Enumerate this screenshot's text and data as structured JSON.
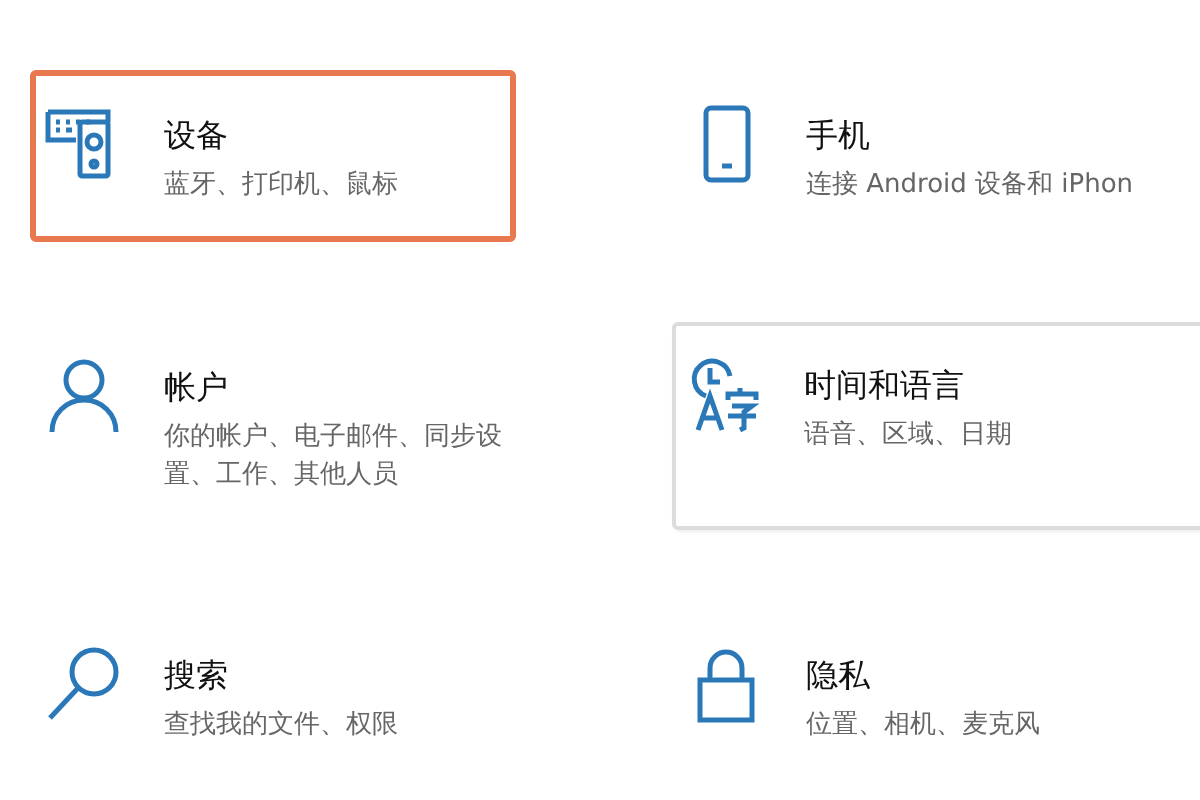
{
  "tiles": [
    {
      "kind": "devices",
      "title": "设备",
      "subtitle": "蓝牙、打印机、鼠标",
      "highlighted": true,
      "hovered": false
    },
    {
      "kind": "phone",
      "title": "手机",
      "subtitle": "连接 Android 设备和 iPhon",
      "highlighted": false,
      "hovered": false
    },
    {
      "kind": "accounts",
      "title": "帐户",
      "subtitle": "你的帐户、电子邮件、同步设置、工作、其他人员",
      "highlighted": false,
      "hovered": false
    },
    {
      "kind": "time-language",
      "title": "时间和语言",
      "subtitle": "语音、区域、日期",
      "highlighted": false,
      "hovered": true
    },
    {
      "kind": "search",
      "title": "搜索",
      "subtitle": "查找我的文件、权限",
      "highlighted": false,
      "hovered": false
    },
    {
      "kind": "privacy",
      "title": "隐私",
      "subtitle": "位置、相机、麦克风",
      "highlighted": false,
      "hovered": false
    }
  ]
}
